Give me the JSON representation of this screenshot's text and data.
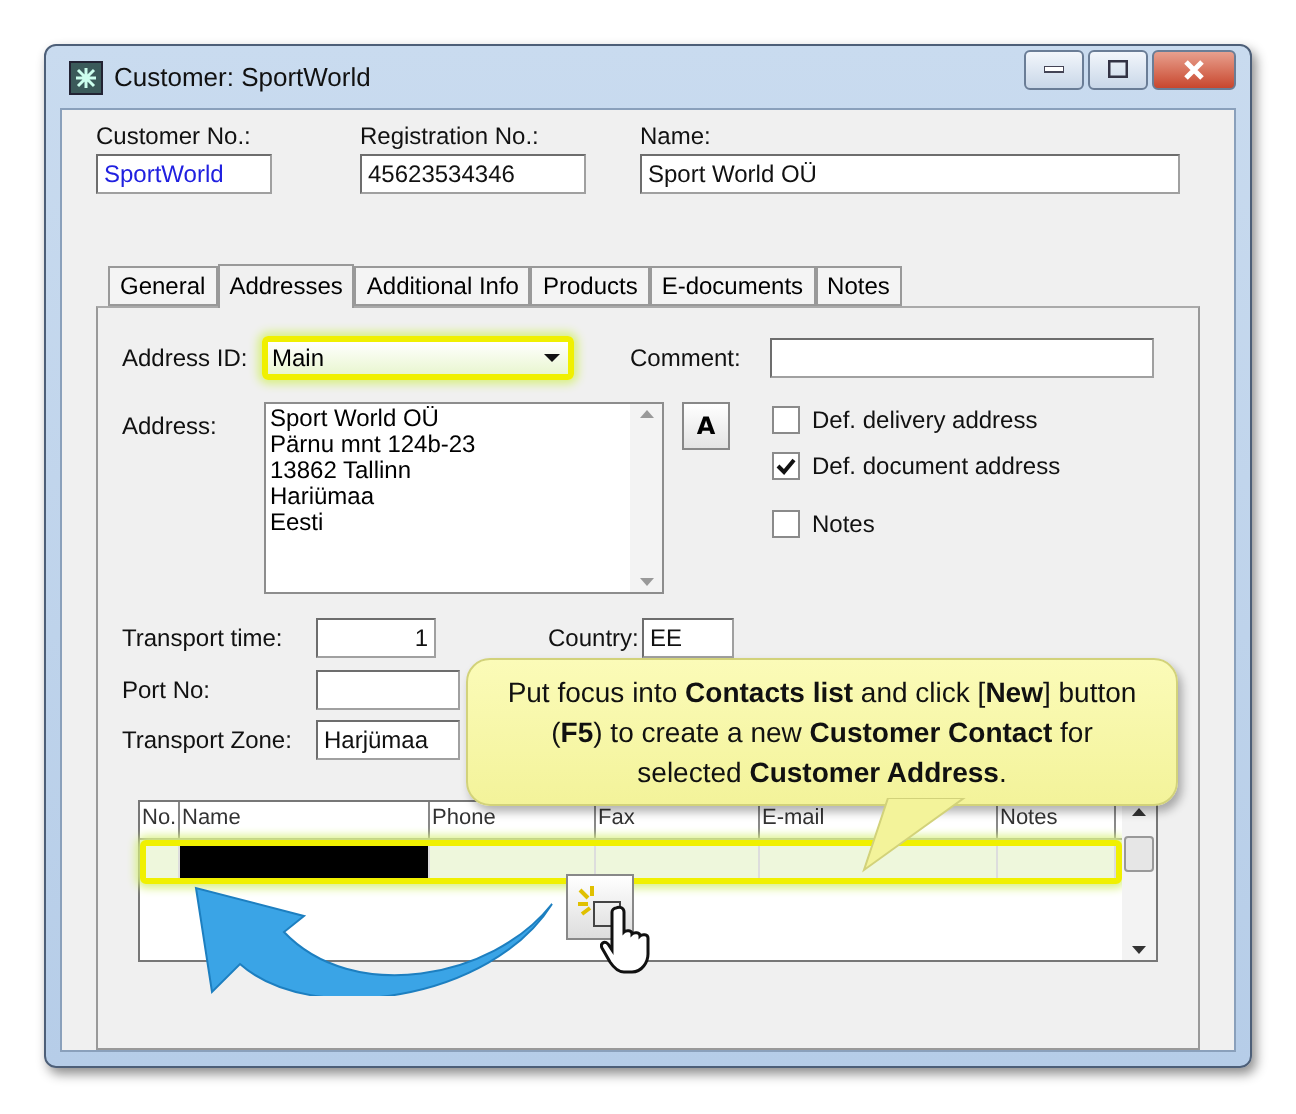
{
  "window": {
    "title": "Customer: SportWorld"
  },
  "header_fields": [
    {
      "label": "Customer No.:",
      "value": "SportWorld",
      "kind": "link"
    },
    {
      "label": "Registration No.:",
      "value": "45623534346",
      "kind": "plain"
    },
    {
      "label": "Name:",
      "value": "Sport World OÜ",
      "kind": "plain"
    }
  ],
  "tabs": [
    {
      "label": "General",
      "selected": false
    },
    {
      "label": "Addresses",
      "selected": true
    },
    {
      "label": "Additional Info",
      "selected": false
    },
    {
      "label": "Products",
      "selected": false
    },
    {
      "label": "E-documents",
      "selected": false
    },
    {
      "label": "Notes",
      "selected": false
    }
  ],
  "address_id": {
    "label": "Address ID:",
    "value": "Main"
  },
  "comment": {
    "label": "Comment:"
  },
  "address": {
    "label": "Address:",
    "lines": [
      "Sport World OÜ",
      "Pärnu mnt 124b-23",
      "13862 Tallinn",
      "Hariümaa",
      "Eesti"
    ]
  },
  "font_button": "A",
  "checkboxes": [
    {
      "label": "Def. delivery address",
      "checked": false
    },
    {
      "label": "Def. document address",
      "checked": true
    },
    {
      "label": "Notes",
      "checked": false
    }
  ],
  "transport_time": {
    "label": "Transport time:",
    "value": "1"
  },
  "country": {
    "label": "Country:",
    "value": "EE"
  },
  "port_no": {
    "label": "Port No:"
  },
  "transport_zone": {
    "label": "Transport Zone:",
    "value": "Harjümaa"
  },
  "contacts": {
    "columns": [
      "No.",
      "Name",
      "Phone",
      "Fax",
      "E-mail",
      "Notes"
    ],
    "rows": [
      {
        "selected": true
      }
    ]
  },
  "callout": "Put focus into **Contacts list** and click [**New**] button (**F5**) to create a new **Customer Contact** for selected **Customer Address**."
}
